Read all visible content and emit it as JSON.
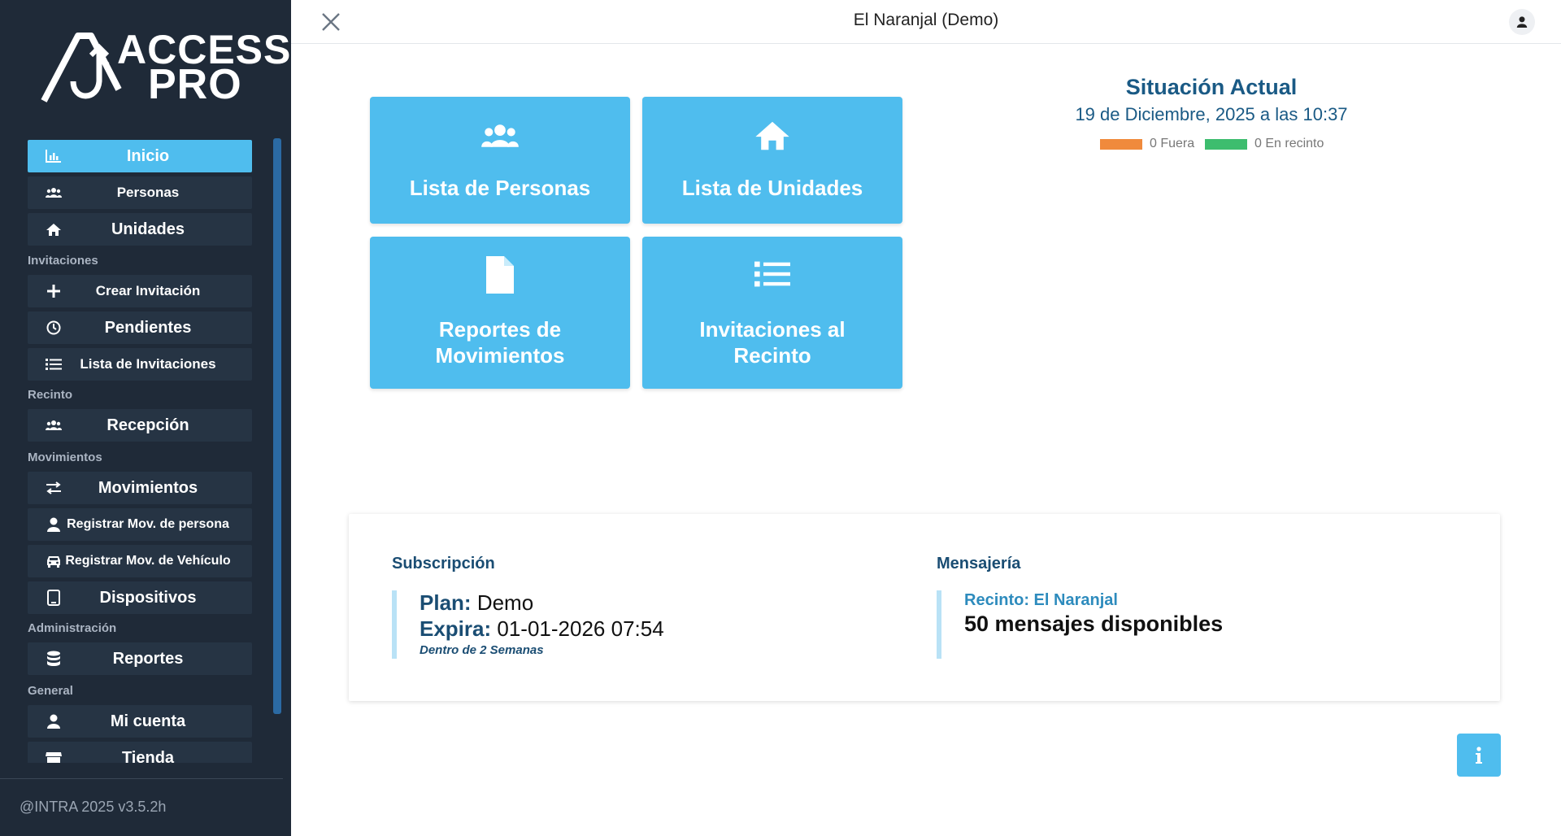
{
  "app": {
    "logo_line1": "ACCESS",
    "logo_line2": "PRO",
    "footer": "@INTRA 2025 v3.5.2h"
  },
  "header": {
    "title": "El Naranjal (Demo)"
  },
  "sidebar": {
    "items": [
      {
        "label": "Inicio",
        "icon": "chart-bar-icon",
        "active": true
      },
      {
        "label": "Personas",
        "icon": "users-icon"
      },
      {
        "label": "Unidades",
        "icon": "home-icon"
      },
      {
        "label": "Crear Invitación",
        "icon": "plus-icon"
      },
      {
        "label": "Pendientes",
        "icon": "clock-icon"
      },
      {
        "label": "Lista de Invitaciones",
        "icon": "list-icon"
      },
      {
        "label": "Recepción",
        "icon": "users-icon"
      },
      {
        "label": "Movimientos",
        "icon": "exchange-icon"
      },
      {
        "label": "Registrar Mov. de persona",
        "icon": "user-icon"
      },
      {
        "label": "Registrar Mov. de Vehículo",
        "icon": "car-icon"
      },
      {
        "label": "Dispositivos",
        "icon": "tablet-icon"
      },
      {
        "label": "Reportes",
        "icon": "database-icon"
      },
      {
        "label": "Mi cuenta",
        "icon": "user-icon"
      },
      {
        "label": "Tienda",
        "icon": "store-icon"
      }
    ],
    "sections": {
      "invitaciones": "Invitaciones",
      "recinto": "Recinto",
      "movimientos": "Movimientos",
      "administracion": "Administración",
      "general": "General"
    }
  },
  "tiles": {
    "personas": "Lista de Personas",
    "unidades": "Lista de Unidades",
    "reportes_l1": "Reportes de",
    "reportes_l2": "Movimientos",
    "invitaciones_l1": "Invitaciones al",
    "invitaciones_l2": "Recinto"
  },
  "situacion": {
    "title": "Situación Actual",
    "date": "19 de Diciembre, 2025 a las 10:37",
    "legend": [
      {
        "label": "0 Fuera",
        "color": "#f08a3c"
      },
      {
        "label": "0 En recinto",
        "color": "#3dbd6e"
      }
    ]
  },
  "subscripcion": {
    "heading": "Subscripción",
    "plan_label": "Plan:",
    "plan_value": "Demo",
    "expira_label": "Expira:",
    "expira_value": "01-01-2026 07:54",
    "note": "Dentro de 2 Semanas"
  },
  "mensajeria": {
    "heading": "Mensajería",
    "recinto": "Recinto: El Naranjal",
    "count": "50 mensajes disponibles"
  },
  "colors": {
    "accent": "#4fbdee",
    "sidebar_bg": "#1f2a38",
    "heading": "#1a5a85"
  }
}
